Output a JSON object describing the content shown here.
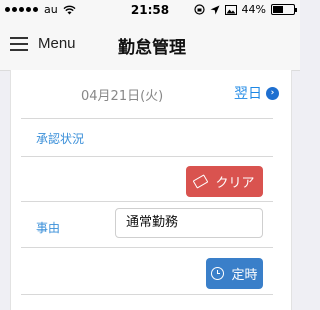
{
  "status_bar": {
    "carrier": "au",
    "time": "21:58",
    "battery": "44%",
    "battery_level": 0.44
  },
  "nav": {
    "menu_label": "Menu",
    "title": "勤怠管理"
  },
  "main": {
    "date": "04月21日(火)",
    "next_label": "翌日",
    "approval_label": "承認状況",
    "clear_button": "クリア",
    "reason_label": "事由",
    "reason_value": "通常勤務",
    "teiji_button": "定時"
  }
}
